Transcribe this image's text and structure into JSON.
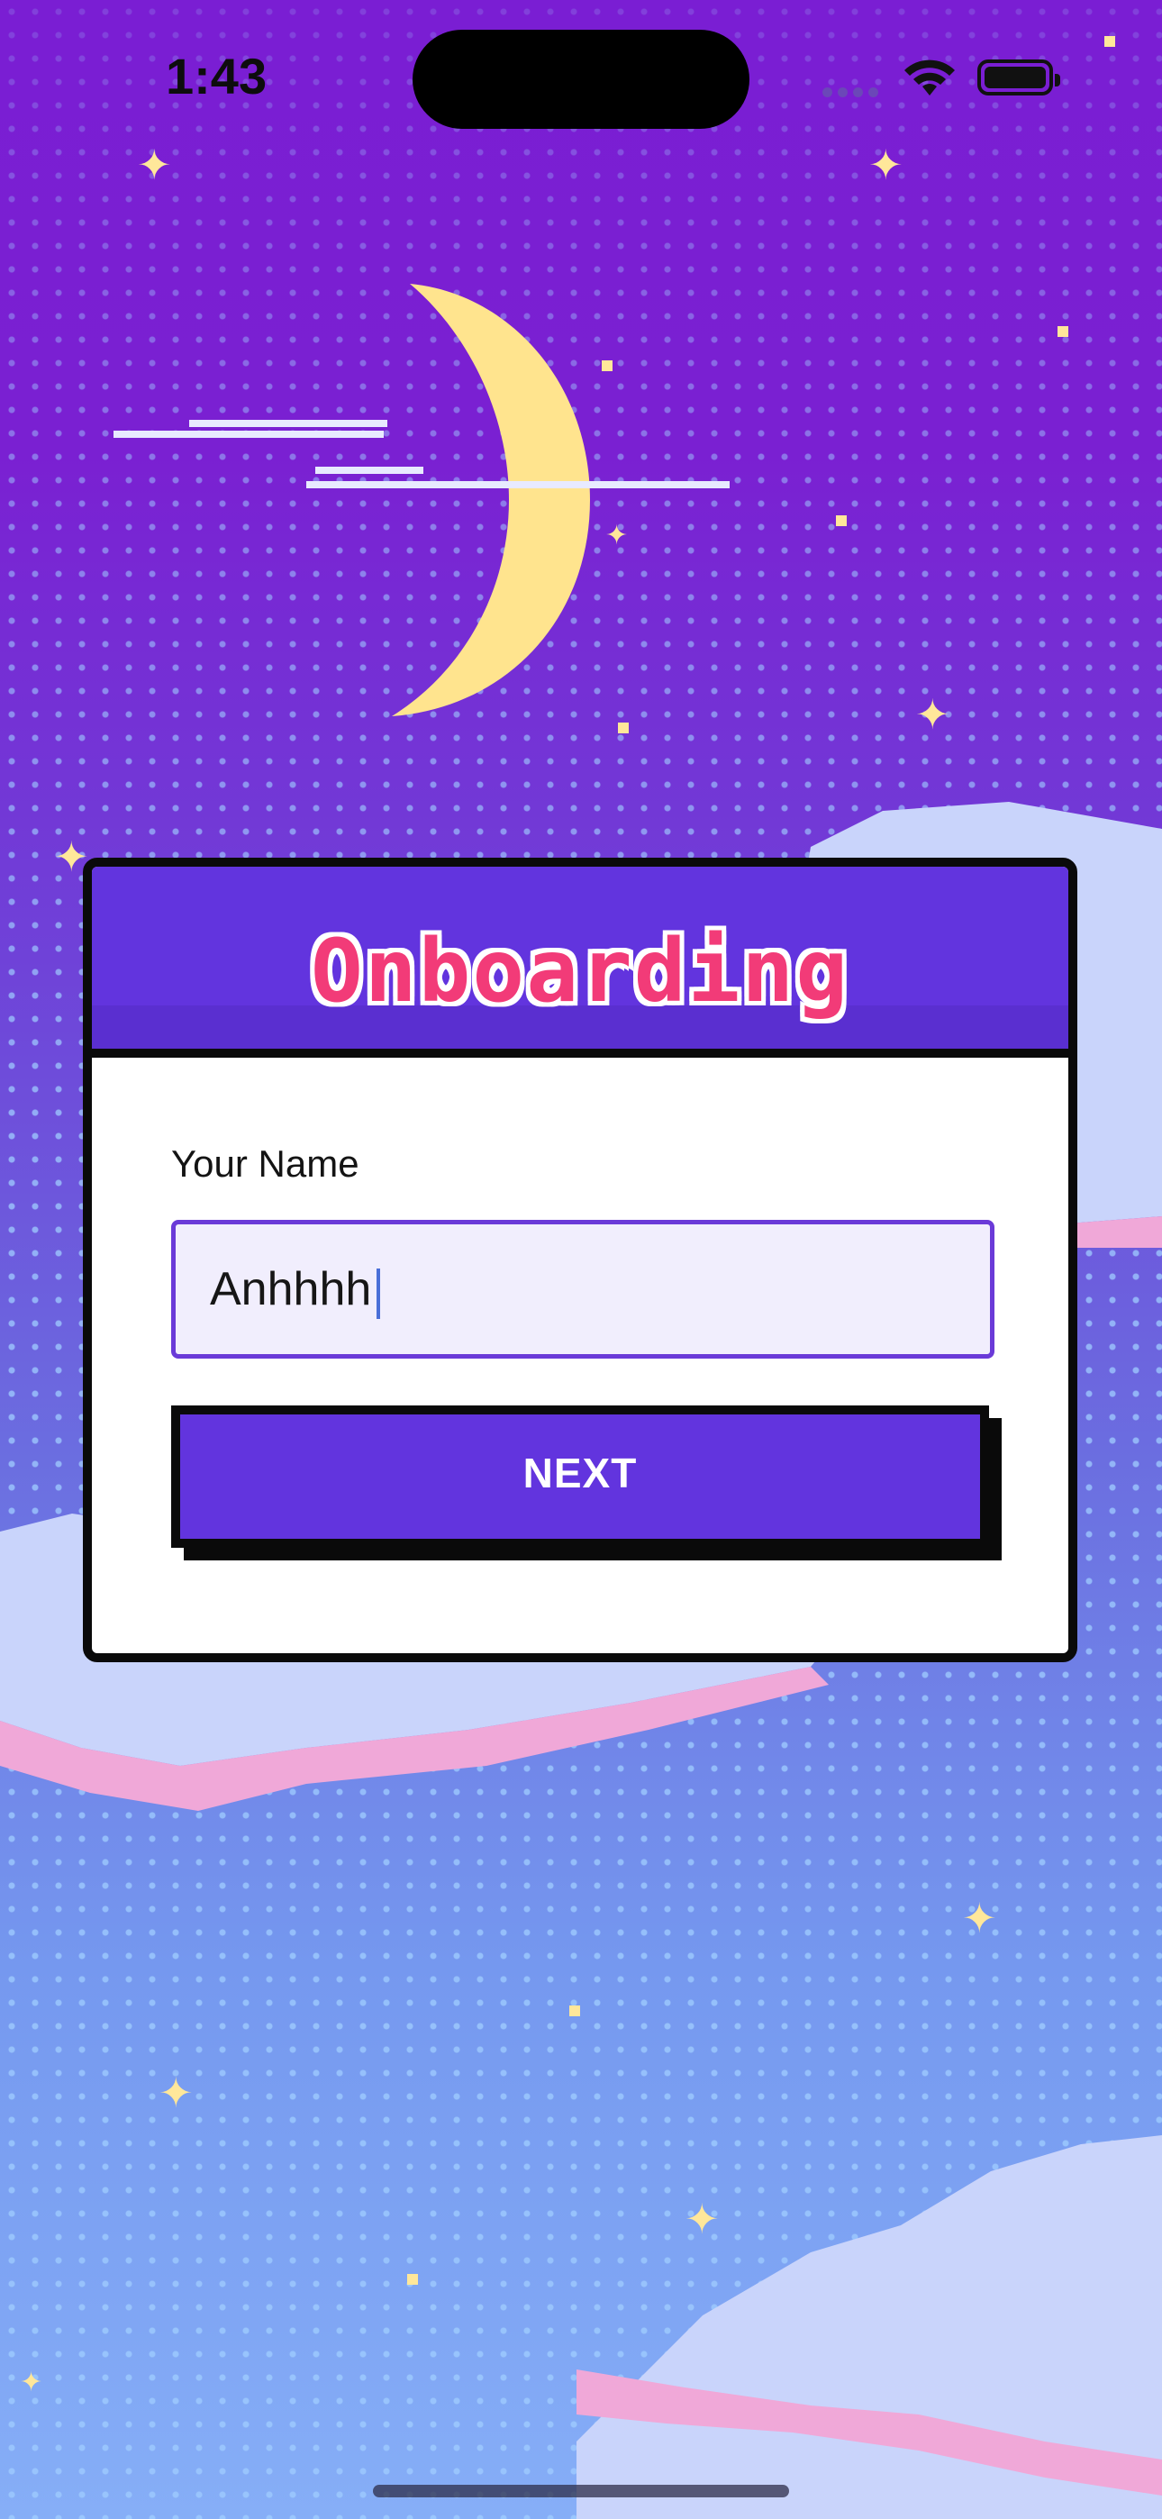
{
  "status_bar": {
    "time": "1:43"
  },
  "onboarding_card": {
    "title": "Onboarding",
    "name_field": {
      "label": "Your Name",
      "value": "Anhhhh"
    },
    "next_button_label": "NEXT"
  },
  "colors": {
    "accent": "#6234DE",
    "title_pink": "#F23B78",
    "input_background": "#F1EEFD",
    "moon_yellow": "#FFE79A"
  },
  "icons": [
    "wifi-icon",
    "battery-icon",
    "moon-icon",
    "star-icon"
  ]
}
